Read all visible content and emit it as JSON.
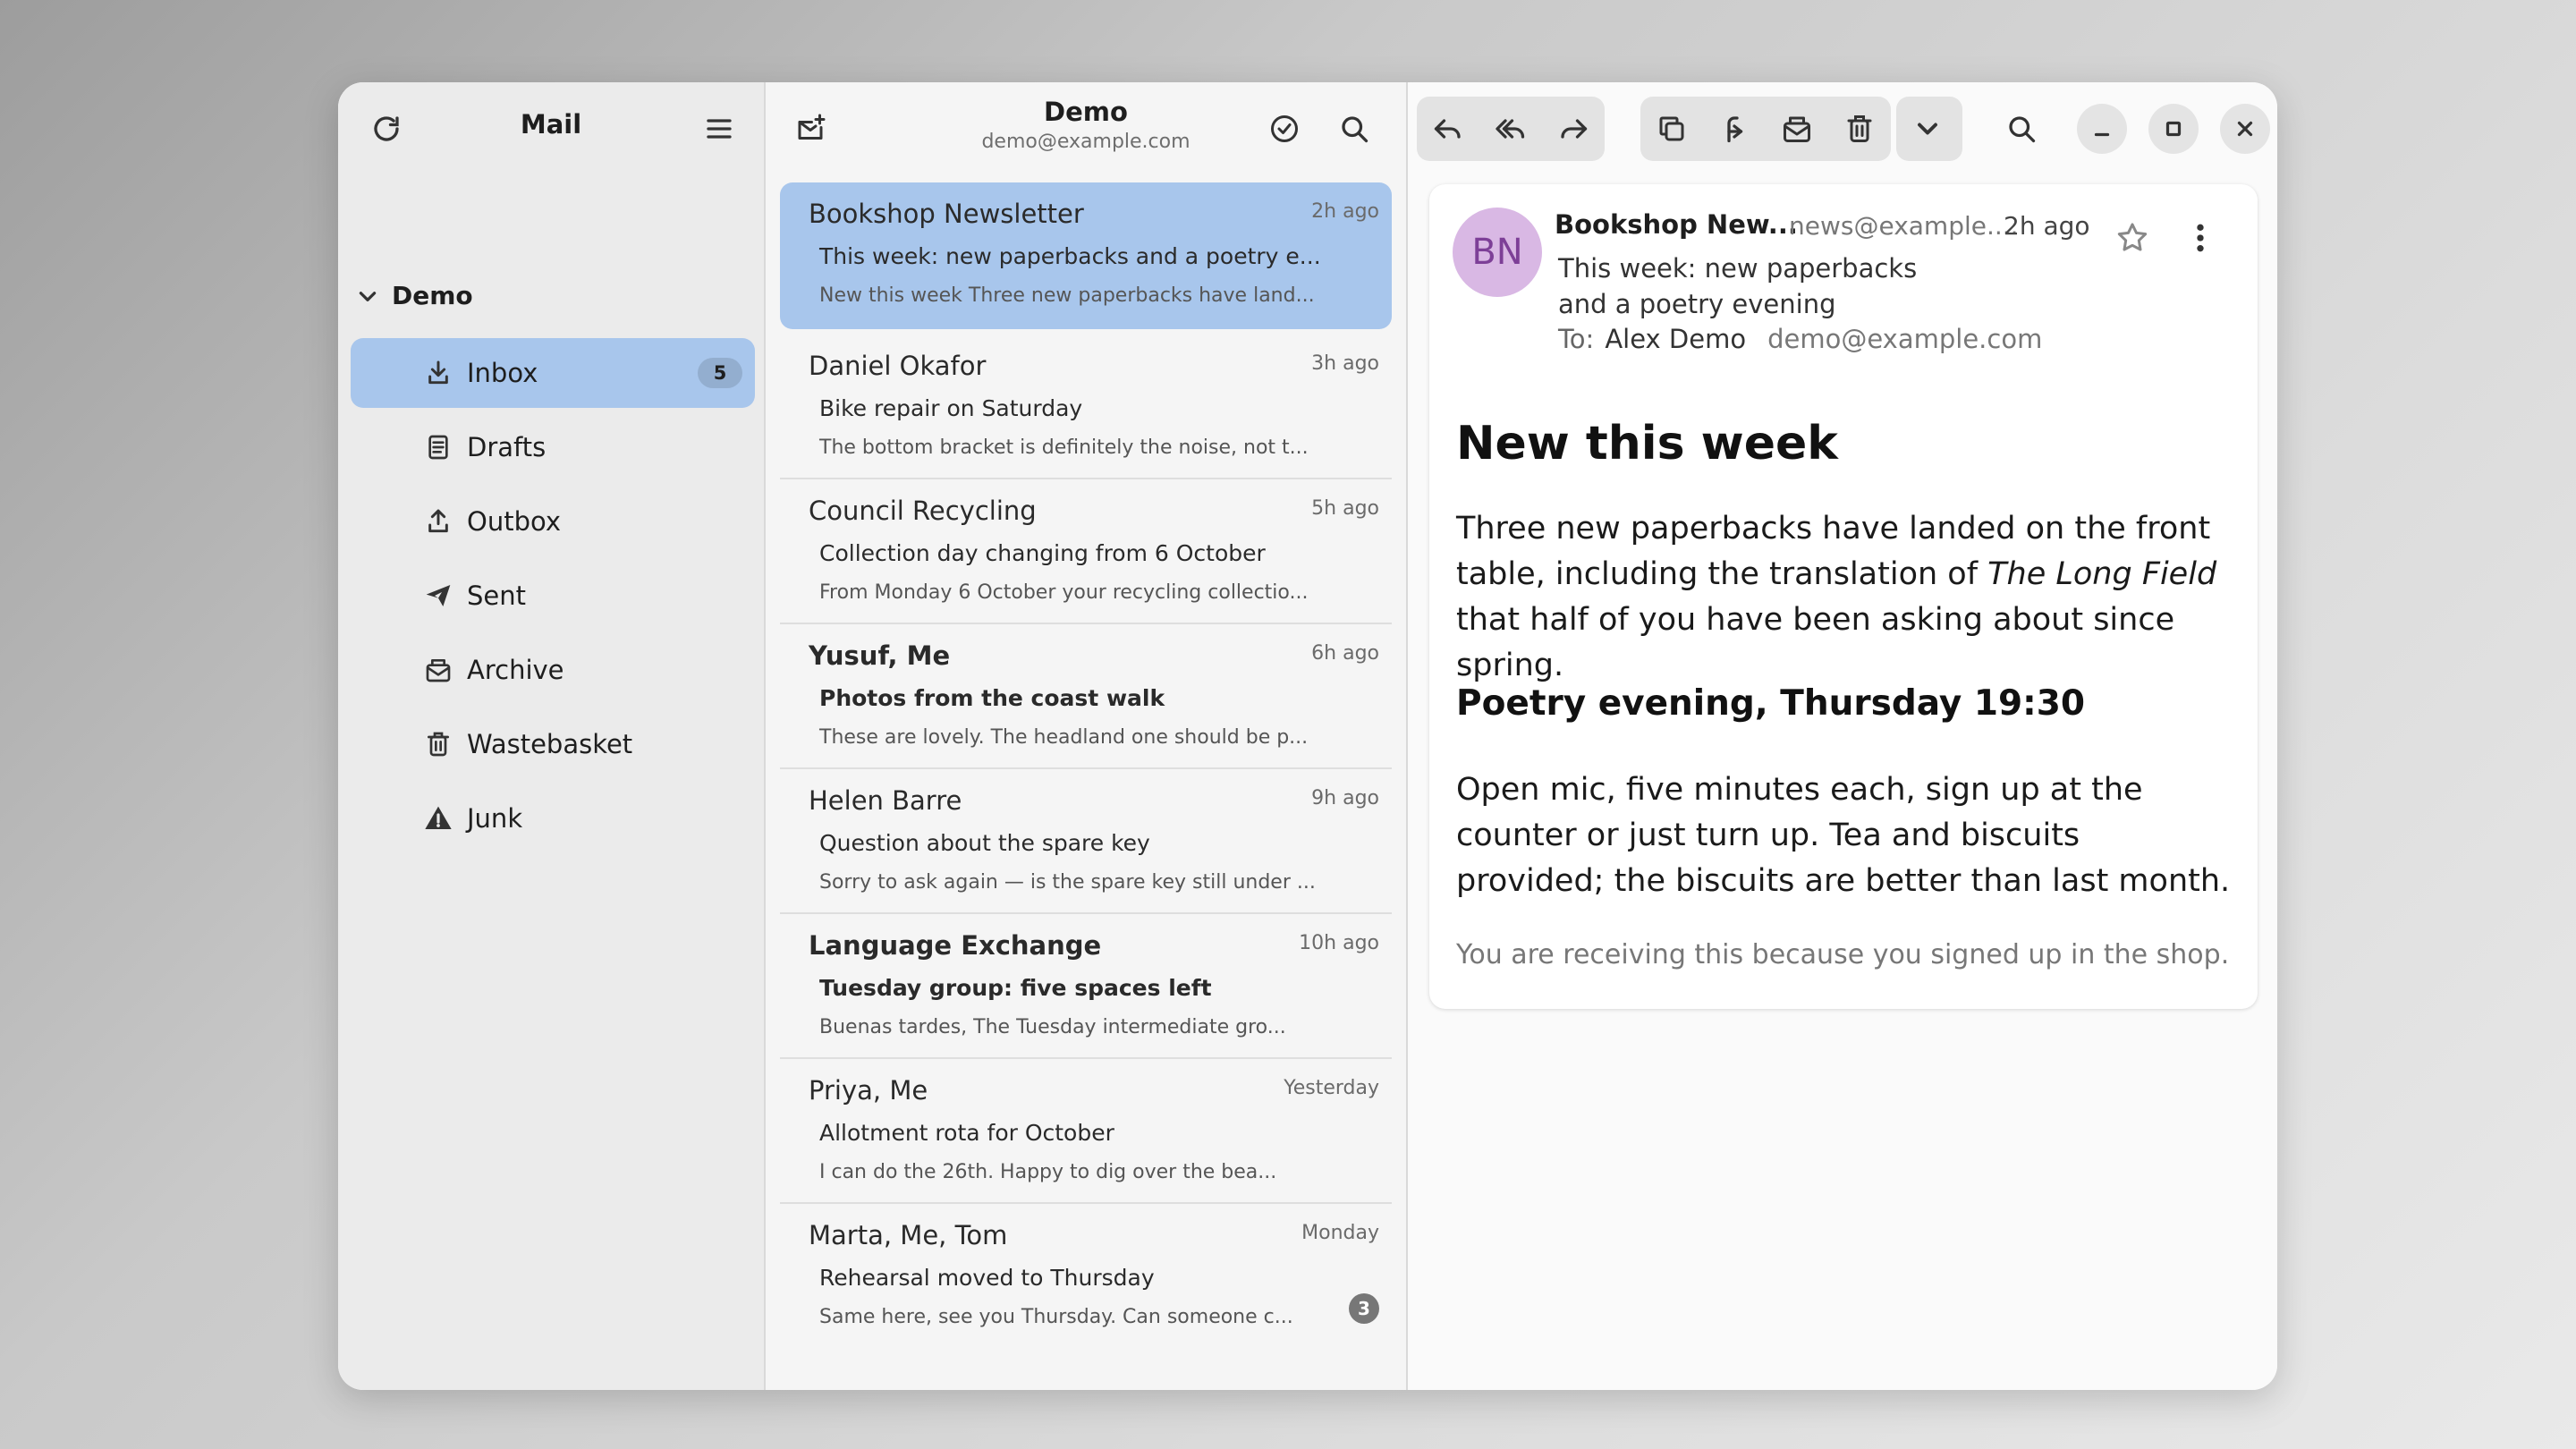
{
  "sidebar": {
    "title": "Mail",
    "account": "Demo",
    "folders": [
      {
        "label": "Inbox",
        "count": "5"
      },
      {
        "label": "Drafts"
      },
      {
        "label": "Outbox"
      },
      {
        "label": "Sent"
      },
      {
        "label": "Archive"
      },
      {
        "label": "Wastebasket"
      },
      {
        "label": "Junk"
      }
    ]
  },
  "list": {
    "title": "Demo",
    "subtitle": "demo@example.com",
    "messages": [
      {
        "from": "Bookshop Newsletter",
        "time": "2h ago",
        "subject": "This week: new paperbacks and a poetry e...",
        "preview": "New this week Three new paperbacks have land..."
      },
      {
        "from": "Daniel Okafor",
        "time": "3h ago",
        "subject": "Bike repair on Saturday",
        "preview": "The bottom bracket is definitely the noise, not t..."
      },
      {
        "from": "Council Recycling",
        "time": "5h ago",
        "subject": "Collection day changing from 6 October",
        "preview": "From Monday 6 October your recycling collectio..."
      },
      {
        "from": "Yusuf, Me",
        "time": "6h ago",
        "subject": "Photos from the coast walk",
        "preview": "These are lovely. The headland one should be p..."
      },
      {
        "from": "Helen Barre",
        "time": "9h ago",
        "subject": "Question about the spare key",
        "preview": "Sorry to ask again — is the spare key still under ..."
      },
      {
        "from": "Language Exchange",
        "time": "10h ago",
        "subject": "Tuesday group: five spaces left",
        "preview": "Buenas tardes, The Tuesday intermediate gro..."
      },
      {
        "from": "Priya, Me",
        "time": "Yesterday",
        "subject": "Allotment rota for October",
        "preview": "I can do the 26th. Happy to dig over the bea..."
      },
      {
        "from": "Marta, Me, Tom",
        "time": "Monday",
        "subject": "Rehearsal moved to Thursday",
        "preview": "Same here, see you Thursday. Can someone c...",
        "thread_count": "3"
      }
    ]
  },
  "reader": {
    "avatar_initials": "BN",
    "from": "Bookshop New...",
    "email": "news@example....",
    "time": "2h ago",
    "subject_line1": "This week: new paperbacks",
    "subject_line2": "and a poetry evening",
    "to_label": "To:",
    "to_name": "Alex Demo",
    "to_email": "demo@example.com",
    "heading": "New this week",
    "para1_before": "Three new paperbacks have landed on the front table, including the translation of ",
    "para1_italic": "The Long Field",
    "para1_after": " that half of you have been asking about since spring.",
    "heading2": "Poetry evening, Thursday 19:30",
    "para2": "Open mic, five minutes each, sign up at the counter or just turn up. Tea and biscuits provided; the biscuits are better than last month.",
    "footer": "You are receiving this because you signed up in the shop."
  },
  "colors": {
    "selection": "#a8c6ec",
    "avatar_bg": "#d9b8e4",
    "avatar_fg": "#7d3f97"
  }
}
